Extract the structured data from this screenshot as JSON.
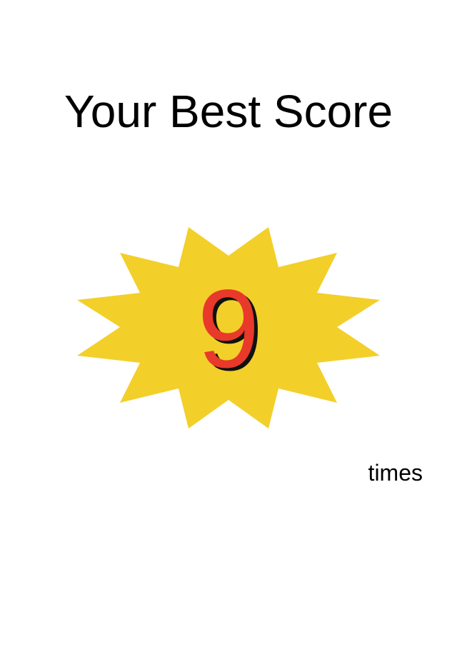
{
  "screen": {
    "title": "Your Best Score",
    "score": "9",
    "unit": "times"
  },
  "colors": {
    "background": "#ffffff",
    "burst_fill": "#f3cf2a",
    "score_fill": "#e8392b",
    "score_shadow": "#111111",
    "text": "#000000"
  },
  "icons": {
    "burst": "starburst-icon"
  }
}
